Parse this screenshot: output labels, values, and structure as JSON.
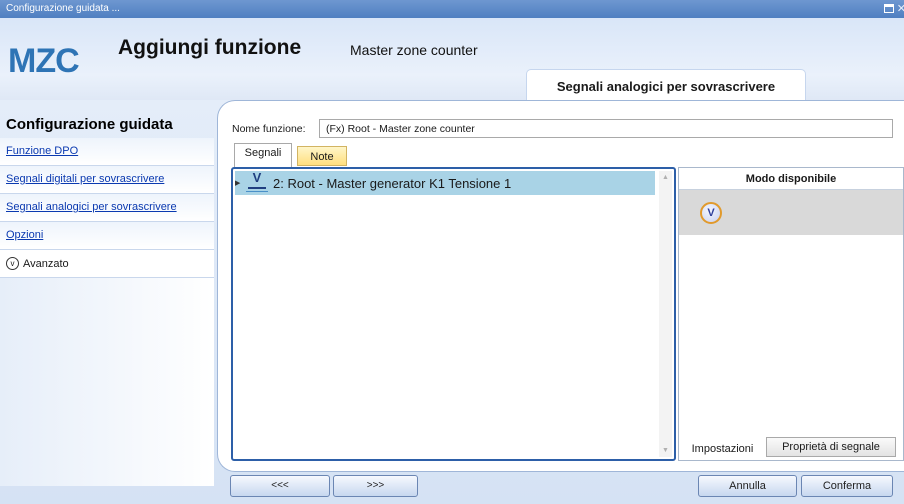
{
  "window": {
    "title": "Configurazione guidata ..."
  },
  "header": {
    "logo": "MZC",
    "title": "Aggiungi funzione",
    "subtitle": "Master zone counter",
    "step_title": "Segnali analogici per sovrascrivere"
  },
  "sidebar": {
    "heading": "Configurazione guidata",
    "items": [
      {
        "label": "Funzione DPO"
      },
      {
        "label": "Segnali digitali per sovrascrivere"
      },
      {
        "label": "Segnali analogici per sovrascrivere"
      },
      {
        "label": "Opzioni"
      }
    ],
    "advanced_label": "Avanzato"
  },
  "form": {
    "name_label": "Nome funzione:",
    "name_value": "(Fx) Root - Master zone counter"
  },
  "tabs": {
    "signals": "Segnali",
    "notes": "Note"
  },
  "signals": {
    "rows": [
      {
        "icon": "voltage-v-icon",
        "label": "2: Root - Master generator K1 Tensione 1"
      }
    ]
  },
  "modes": {
    "header": "Modo disponibile",
    "icon": "v-mode-icon",
    "tab_settings": "Impostazioni",
    "tab_properties": "Proprietà di segnale"
  },
  "footer": {
    "prev": "<<<",
    "next": ">>>",
    "cancel": "Annulla",
    "confirm": "Conferma"
  }
}
